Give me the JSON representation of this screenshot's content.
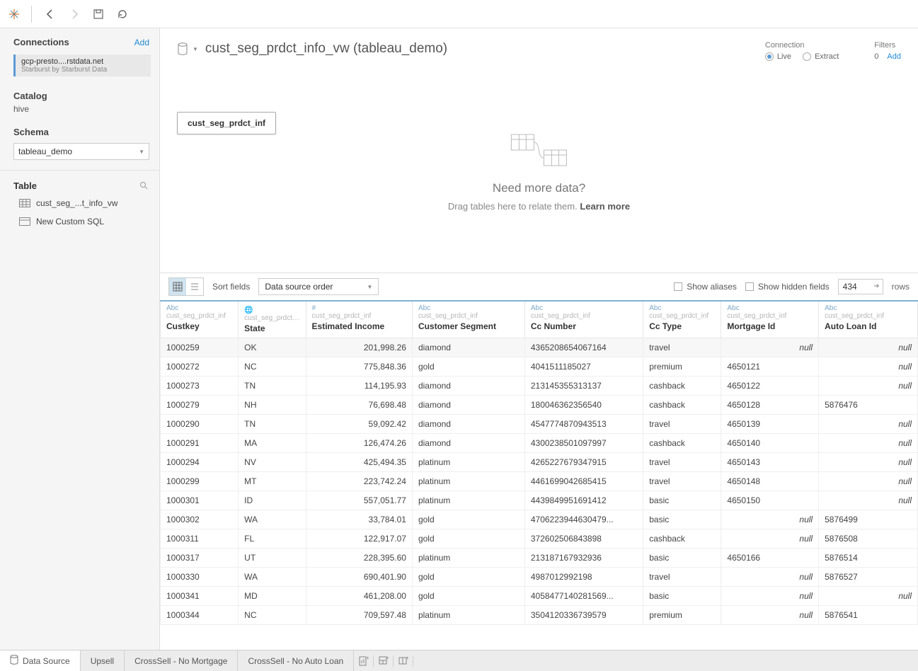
{
  "toolbar": {},
  "sidebar": {
    "connections_label": "Connections",
    "add_label": "Add",
    "connection": {
      "name": "gcp-presto....rstdata.net",
      "sub": "Starburst by Starburst Data"
    },
    "catalog_label": "Catalog",
    "catalog_value": "hive",
    "schema_label": "Schema",
    "schema_value": "tableau_demo",
    "table_label": "Table",
    "table_item": "cust_seg_...t_info_vw",
    "new_sql": "New Custom SQL"
  },
  "ds": {
    "title": "cust_seg_prdct_info_vw (tableau_demo)",
    "connection_label": "Connection",
    "live_label": "Live",
    "extract_label": "Extract",
    "filters_label": "Filters",
    "filters_count": "0",
    "add_label": "Add"
  },
  "canvas": {
    "pill": "cust_seg_prdct_inf",
    "nm_title": "Need more data?",
    "nm_sub_1": "Drag tables here to relate them. ",
    "nm_learn": "Learn more"
  },
  "gridbar": {
    "sort_label": "Sort fields",
    "sort_value": "Data source order",
    "show_aliases": "Show aliases",
    "show_hidden": "Show hidden fields",
    "rows_value": "434",
    "rows_label": "rows"
  },
  "columns": [
    {
      "type": "Abc",
      "src": "cust_seg_prdct_inf",
      "name": "Custkey"
    },
    {
      "type": "globe",
      "src": "cust_seg_prdct_...",
      "name": "State"
    },
    {
      "type": "#",
      "src": "cust_seg_prdct_inf",
      "name": "Estimated Income"
    },
    {
      "type": "Abc",
      "src": "cust_seg_prdct_inf",
      "name": "Customer Segment"
    },
    {
      "type": "Abc",
      "src": "cust_seg_prdct_inf",
      "name": "Cc Number"
    },
    {
      "type": "Abc",
      "src": "cust_seg_prdct_inf",
      "name": "Cc Type"
    },
    {
      "type": "Abc",
      "src": "cust_seg_prdct_inf",
      "name": "Mortgage Id"
    },
    {
      "type": "Abc",
      "src": "cust_seg_prdct_inf",
      "name": "Auto Loan Id"
    }
  ],
  "rows": [
    [
      "1000259",
      "OK",
      "201,998.26",
      "diamond",
      "4365208654067164",
      "travel",
      null,
      null
    ],
    [
      "1000272",
      "NC",
      "775,848.36",
      "gold",
      "4041511185027",
      "premium",
      "4650121",
      null
    ],
    [
      "1000273",
      "TN",
      "114,195.93",
      "diamond",
      "213145355313137",
      "cashback",
      "4650122",
      null
    ],
    [
      "1000279",
      "NH",
      "76,698.48",
      "diamond",
      "180046362356540",
      "cashback",
      "4650128",
      "5876476"
    ],
    [
      "1000290",
      "TN",
      "59,092.42",
      "diamond",
      "4547774870943513",
      "travel",
      "4650139",
      null
    ],
    [
      "1000291",
      "MA",
      "126,474.26",
      "diamond",
      "4300238501097997",
      "cashback",
      "4650140",
      null
    ],
    [
      "1000294",
      "NV",
      "425,494.35",
      "platinum",
      "4265227679347915",
      "travel",
      "4650143",
      null
    ],
    [
      "1000299",
      "MT",
      "223,742.24",
      "platinum",
      "4461699042685415",
      "travel",
      "4650148",
      null
    ],
    [
      "1000301",
      "ID",
      "557,051.77",
      "platinum",
      "4439849951691412",
      "basic",
      "4650150",
      null
    ],
    [
      "1000302",
      "WA",
      "33,784.01",
      "gold",
      "4706223944630479...",
      "basic",
      null,
      "5876499"
    ],
    [
      "1000311",
      "FL",
      "122,917.07",
      "gold",
      "372602506843898",
      "cashback",
      null,
      "5876508"
    ],
    [
      "1000317",
      "UT",
      "228,395.60",
      "platinum",
      "213187167932936",
      "basic",
      "4650166",
      "5876514"
    ],
    [
      "1000330",
      "WA",
      "690,401.90",
      "gold",
      "4987012992198",
      "travel",
      null,
      "5876527"
    ],
    [
      "1000341",
      "MD",
      "461,208.00",
      "gold",
      "4058477140281569...",
      "basic",
      null,
      null
    ],
    [
      "1000344",
      "NC",
      "709,597.48",
      "platinum",
      "3504120336739579",
      "premium",
      null,
      "5876541"
    ]
  ],
  "tabs": {
    "datasource": "Data Source",
    "t1": "Upsell",
    "t2": "CrossSell - No Mortgage",
    "t3": "CrossSell - No Auto Loan"
  }
}
